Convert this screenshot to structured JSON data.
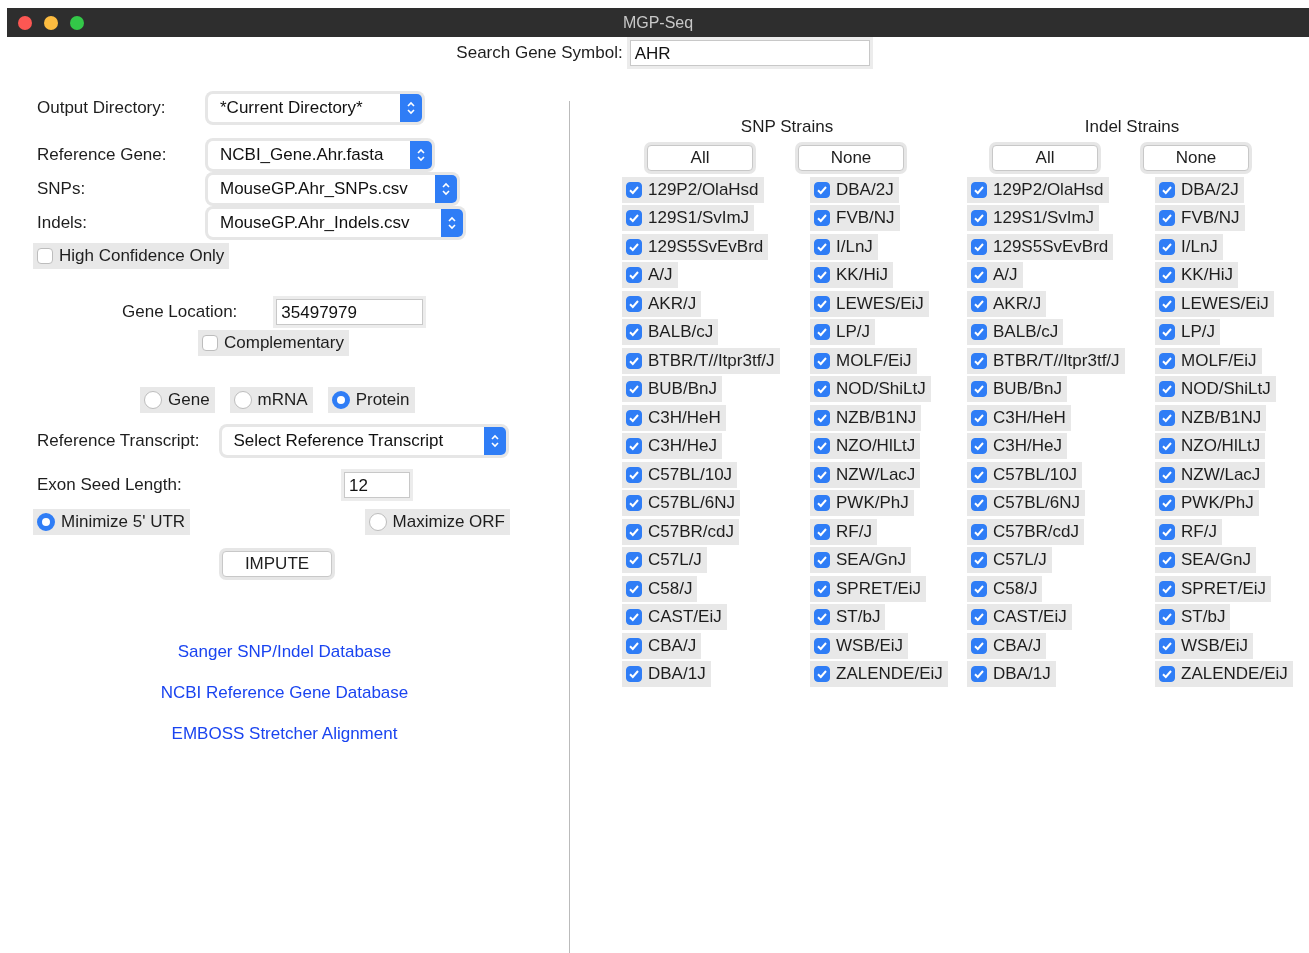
{
  "window": {
    "title": "MGP-Seq"
  },
  "search": {
    "label": "Search Gene Symbol:",
    "value": "AHR"
  },
  "file_selects": [
    {
      "label": "Output Directory:",
      "value": "*Current Directory*"
    },
    {
      "label": "Reference Gene:",
      "value": "NCBI_Gene.Ahr.fasta"
    },
    {
      "label": "SNPs:",
      "value": "MouseGP.Ahr_SNPs.csv"
    },
    {
      "label": "Indels:",
      "value": "MouseGP.Ahr_Indels.csv"
    }
  ],
  "high_confidence": {
    "label": "High Confidence Only",
    "checked": false
  },
  "gene_location": {
    "label": "Gene Location:",
    "value": "35497979"
  },
  "complementary": {
    "label": "Complementary",
    "checked": false
  },
  "sequence_type": [
    {
      "label": "Gene",
      "selected": false
    },
    {
      "label": "mRNA",
      "selected": false
    },
    {
      "label": "Protein",
      "selected": true
    }
  ],
  "reference_transcript": {
    "label": "Reference Transcript:",
    "value": "Select Reference Transcript"
  },
  "exon_seed_length": {
    "label": "Exon Seed Length:",
    "value": "12"
  },
  "orf_mode": [
    {
      "label": "Minimize 5' UTR",
      "selected": true
    },
    {
      "label": "Maximize ORF",
      "selected": false
    }
  ],
  "impute_button": "IMPUTE",
  "links": [
    "Sanger SNP/Indel Database",
    "NCBI Reference Gene Database",
    "EMBOSS Stretcher Alignment"
  ],
  "strain_groups": [
    {
      "title": "SNP Strains",
      "buttons": [
        "All",
        "None"
      ],
      "columns": [
        [
          {
            "label": "129P2/OlaHsd",
            "checked": true
          },
          {
            "label": "129S1/SvImJ",
            "checked": true
          },
          {
            "label": "129S5SvEvBrd",
            "checked": true
          },
          {
            "label": "A/J",
            "checked": true
          },
          {
            "label": "AKR/J",
            "checked": true
          },
          {
            "label": "BALB/cJ",
            "checked": true
          },
          {
            "label": "BTBR/T//Itpr3tf/J",
            "checked": true
          },
          {
            "label": "BUB/BnJ",
            "checked": true
          },
          {
            "label": "C3H/HeH",
            "checked": true
          },
          {
            "label": "C3H/HeJ",
            "checked": true
          },
          {
            "label": "C57BL/10J",
            "checked": true
          },
          {
            "label": "C57BL/6NJ",
            "checked": true
          },
          {
            "label": "C57BR/cdJ",
            "checked": true
          },
          {
            "label": "C57L/J",
            "checked": true
          },
          {
            "label": "C58/J",
            "checked": true
          },
          {
            "label": "CAST/EiJ",
            "checked": true
          },
          {
            "label": "CBA/J",
            "checked": true
          },
          {
            "label": "DBA/1J",
            "checked": true
          }
        ],
        [
          {
            "label": "DBA/2J",
            "checked": true
          },
          {
            "label": "FVB/NJ",
            "checked": true
          },
          {
            "label": "I/LnJ",
            "checked": true
          },
          {
            "label": "KK/HiJ",
            "checked": true
          },
          {
            "label": "LEWES/EiJ",
            "checked": true
          },
          {
            "label": "LP/J",
            "checked": true
          },
          {
            "label": "MOLF/EiJ",
            "checked": true
          },
          {
            "label": "NOD/ShiLtJ",
            "checked": true
          },
          {
            "label": "NZB/B1NJ",
            "checked": true
          },
          {
            "label": "NZO/HlLtJ",
            "checked": true
          },
          {
            "label": "NZW/LacJ",
            "checked": true
          },
          {
            "label": "PWK/PhJ",
            "checked": true
          },
          {
            "label": "RF/J",
            "checked": true
          },
          {
            "label": "SEA/GnJ",
            "checked": true
          },
          {
            "label": "SPRET/EiJ",
            "checked": true
          },
          {
            "label": "ST/bJ",
            "checked": true
          },
          {
            "label": "WSB/EiJ",
            "checked": true
          },
          {
            "label": "ZALENDE/EiJ",
            "checked": true
          }
        ]
      ]
    },
    {
      "title": "Indel Strains",
      "buttons": [
        "All",
        "None"
      ],
      "columns": [
        [
          {
            "label": "129P2/OlaHsd",
            "checked": true
          },
          {
            "label": "129S1/SvImJ",
            "checked": true
          },
          {
            "label": "129S5SvEvBrd",
            "checked": true
          },
          {
            "label": "A/J",
            "checked": true
          },
          {
            "label": "AKR/J",
            "checked": true
          },
          {
            "label": "BALB/cJ",
            "checked": true
          },
          {
            "label": "BTBR/T//Itpr3tf/J",
            "checked": true
          },
          {
            "label": "BUB/BnJ",
            "checked": true
          },
          {
            "label": "C3H/HeH",
            "checked": true
          },
          {
            "label": "C3H/HeJ",
            "checked": true
          },
          {
            "label": "C57BL/10J",
            "checked": true
          },
          {
            "label": "C57BL/6NJ",
            "checked": true
          },
          {
            "label": "C57BR/cdJ",
            "checked": true
          },
          {
            "label": "C57L/J",
            "checked": true
          },
          {
            "label": "C58/J",
            "checked": true
          },
          {
            "label": "CAST/EiJ",
            "checked": true
          },
          {
            "label": "CBA/J",
            "checked": true
          },
          {
            "label": "DBA/1J",
            "checked": true
          }
        ],
        [
          {
            "label": "DBA/2J",
            "checked": true
          },
          {
            "label": "FVB/NJ",
            "checked": true
          },
          {
            "label": "I/LnJ",
            "checked": true
          },
          {
            "label": "KK/HiJ",
            "checked": true
          },
          {
            "label": "LEWES/EiJ",
            "checked": true
          },
          {
            "label": "LP/J",
            "checked": true
          },
          {
            "label": "MOLF/EiJ",
            "checked": true
          },
          {
            "label": "NOD/ShiLtJ",
            "checked": true
          },
          {
            "label": "NZB/B1NJ",
            "checked": true
          },
          {
            "label": "NZO/HlLtJ",
            "checked": true
          },
          {
            "label": "NZW/LacJ",
            "checked": true
          },
          {
            "label": "PWK/PhJ",
            "checked": true
          },
          {
            "label": "RF/J",
            "checked": true
          },
          {
            "label": "SEA/GnJ",
            "checked": true
          },
          {
            "label": "SPRET/EiJ",
            "checked": true
          },
          {
            "label": "ST/bJ",
            "checked": true
          },
          {
            "label": "WSB/EiJ",
            "checked": true
          },
          {
            "label": "ZALENDE/EiJ",
            "checked": true
          }
        ]
      ]
    }
  ]
}
